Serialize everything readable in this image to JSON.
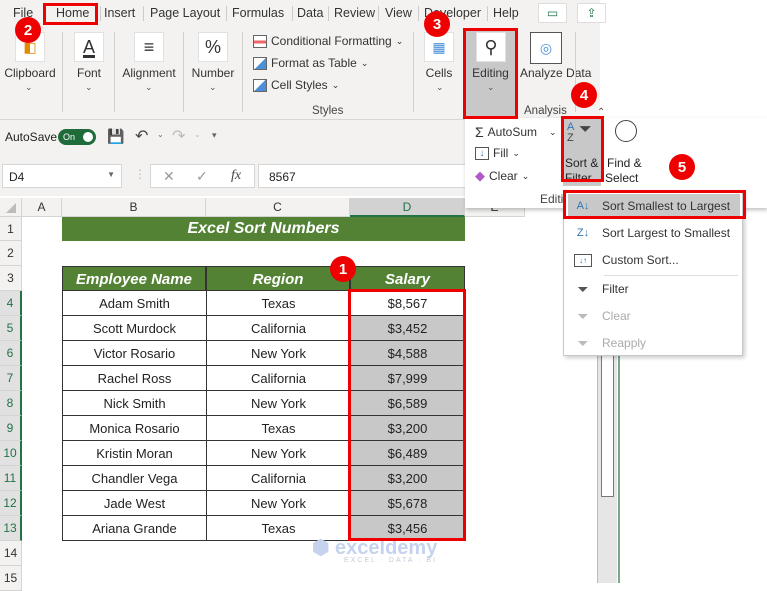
{
  "ribbon": {
    "tabs": [
      "File",
      "Home",
      "Insert",
      "Page Layout",
      "Formulas",
      "Data",
      "Review",
      "View",
      "Developer",
      "Help"
    ],
    "active_tab": "Home",
    "groups": {
      "clipboard": "Clipboard",
      "font": "Font",
      "alignment": "Alignment",
      "number": "Number",
      "styles_label": "Styles",
      "cells": "Cells",
      "editing": "Editing",
      "analyze": "Analyze Data",
      "analysis_label": "Analysis"
    },
    "styles_items": [
      "Conditional Formatting",
      "Format as Table",
      "Cell Styles"
    ]
  },
  "qat": {
    "autosave_label": "AutoSave",
    "toggle_label": "On"
  },
  "formula_bar": {
    "name_box": "D4",
    "fx": "fx",
    "value": "8567"
  },
  "columns": [
    "A",
    "B",
    "C",
    "D",
    "E"
  ],
  "rows": [
    "1",
    "2",
    "3",
    "4",
    "5",
    "6",
    "7",
    "8",
    "9",
    "10",
    "11",
    "12",
    "13",
    "14",
    "15"
  ],
  "sheet": {
    "title": "Excel Sort Numbers",
    "headers": [
      "Employee Name",
      "Region",
      "Salary"
    ],
    "data": [
      [
        "Adam Smith",
        "Texas",
        "$8,567"
      ],
      [
        "Scott Murdock",
        "California",
        "$3,452"
      ],
      [
        "Victor Rosario",
        "New York",
        "$4,588"
      ],
      [
        "Rachel Ross",
        "California",
        "$7,999"
      ],
      [
        "Nick Smith",
        "New York",
        "$6,589"
      ],
      [
        "Monica Rosario",
        "Texas",
        "$3,200"
      ],
      [
        "Kristin Moran",
        "New York",
        "$6,489"
      ],
      [
        "Chandler Vega",
        "California",
        "$3,200"
      ],
      [
        "Jade West",
        "New York",
        "$5,678"
      ],
      [
        "Ariana Grande",
        "Texas",
        "$3,456"
      ]
    ]
  },
  "editing_panel": {
    "autosum": "AutoSum",
    "fill": "Fill",
    "clear": "Clear",
    "sort_filter": [
      "Sort &",
      "Filter"
    ],
    "find_select": [
      "Find &",
      "Select"
    ],
    "group_label": "Editi"
  },
  "sort_menu": {
    "items": [
      {
        "label": "Sort Smallest to Largest",
        "icon": "sort-a-z-icon",
        "enabled": true,
        "highlighted": true
      },
      {
        "label": "Sort Largest to Smallest",
        "icon": "sort-z-a-icon",
        "enabled": true
      },
      {
        "label": "Custom Sort...",
        "icon": "custom-sort-icon",
        "enabled": true
      },
      {
        "label": "Filter",
        "icon": "filter-icon",
        "enabled": true
      },
      {
        "label": "Clear",
        "icon": "clear-filter-icon",
        "enabled": false
      },
      {
        "label": "Reapply",
        "icon": "reapply-icon",
        "enabled": false
      }
    ]
  },
  "badges": [
    "1",
    "2",
    "3",
    "4",
    "5"
  ],
  "watermark": {
    "name": "exceldemy",
    "tagline": "EXCEL · DATA · BI"
  },
  "colors": {
    "header_green": "#548235",
    "annotation_red": "#e00000",
    "excel_green": "#217346"
  }
}
